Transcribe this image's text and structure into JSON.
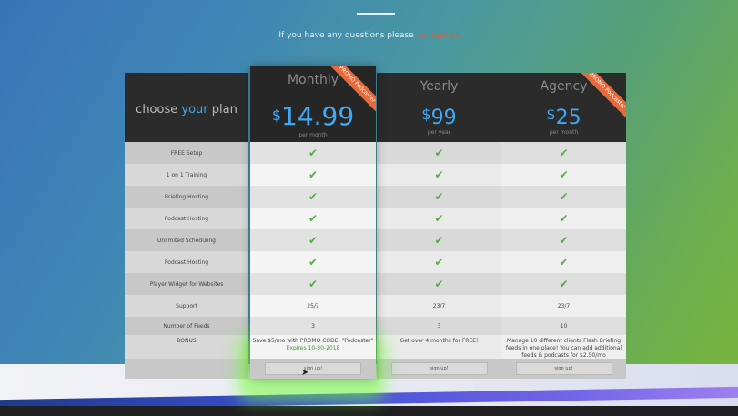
{
  "contact": {
    "text": "If you have any questions please",
    "link": "contact us"
  },
  "labels_column": {
    "title_pre": "choose ",
    "title_em": "your",
    "title_post": " plan",
    "features": [
      "FREE Setup",
      "1 on 1 Training",
      "Briefing Hosting",
      "Podcast Hosting",
      "Unlimited Scheduling",
      "Podcast Hosting",
      "Player Widget for Websites",
      "Support",
      "Number of Feeds",
      "BONUS"
    ]
  },
  "plans": [
    {
      "name": "Monthly",
      "price": "14.99",
      "currency": "$",
      "period": "per month",
      "ribbon": "PROMO Podcaster",
      "support": "25/7",
      "feeds": "3",
      "bonus": "Save $5/mo with PROMO CODE: \"Podcaster\"",
      "bonus_expires": "Expires 10-30-2018",
      "signup": "sign up!"
    },
    {
      "name": "Yearly",
      "price": "99",
      "currency": "$",
      "period": "per year",
      "support": "23/7",
      "feeds": "3",
      "bonus": "Get over 4 months for FREE!",
      "signup": "sign up!"
    },
    {
      "name": "Agency",
      "price": "25",
      "currency": "$",
      "period": "per month",
      "ribbon": "PROMO Podcaster",
      "support": "23/7",
      "feeds": "10",
      "bonus": "Manage 10 different clients Flash Briefing feeds in one place! You can add additional feeds & podcasts for $2.50/mo",
      "signup": "sign up!"
    }
  ],
  "check_glyph": "✔",
  "colors": {
    "accent_blue": "#3fa9f5",
    "check_green": "#52b043",
    "ribbon_orange": "#e8693a",
    "glow_green": "#78ff3c"
  }
}
